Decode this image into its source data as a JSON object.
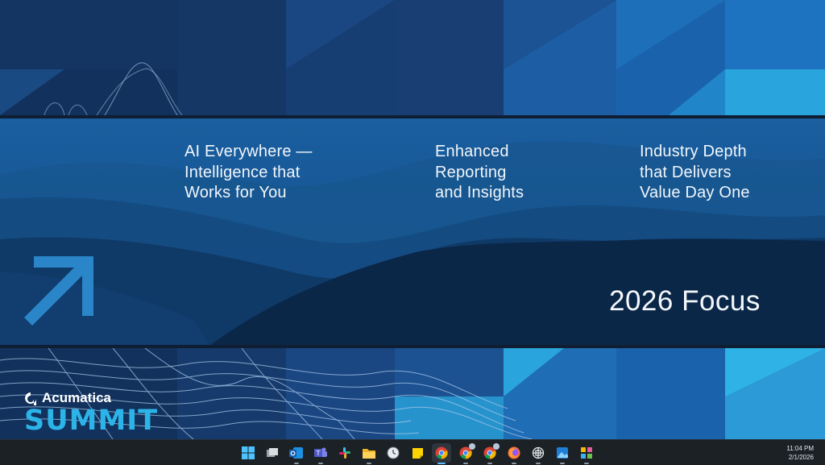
{
  "slide": {
    "columns": [
      {
        "text": "AI Everywhere —\nIntelligence that\nWorks for You"
      },
      {
        "text": "Enhanced\nReporting\nand Insights"
      },
      {
        "text": "Industry Depth\nthat Delivers\nValue Day One"
      }
    ],
    "focus_title": "2026 Focus",
    "logo": {
      "brand": "Acumatica",
      "event": "SUMMIT"
    }
  },
  "taskbar": {
    "icons": [
      {
        "name": "windows-start-icon"
      },
      {
        "name": "task-view-icon"
      },
      {
        "name": "outlook-icon"
      },
      {
        "name": "teams-icon"
      },
      {
        "name": "slack-icon"
      },
      {
        "name": "file-explorer-icon"
      },
      {
        "name": "clock-app-icon"
      },
      {
        "name": "sticky-notes-icon"
      },
      {
        "name": "chrome-icon"
      },
      {
        "name": "chrome-icon"
      },
      {
        "name": "chrome-icon"
      },
      {
        "name": "firefox-icon"
      },
      {
        "name": "chatgpt-icon"
      },
      {
        "name": "photos-icon"
      },
      {
        "name": "snip-tool-icon"
      }
    ],
    "clock": {
      "time": "11:04 PM",
      "date": "2/1/2026"
    }
  },
  "colors": {
    "dark_navy": "#0b2a52",
    "mid_blue": "#1670b3",
    "bright_blue": "#2cb4e8",
    "taskbar": "#1c2126"
  }
}
